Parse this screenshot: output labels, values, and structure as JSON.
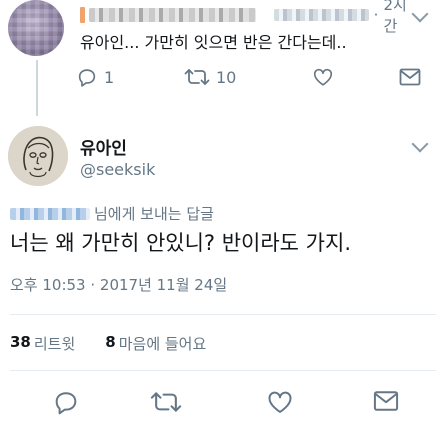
{
  "parent_tweet": {
    "time": "2시간",
    "separator": "·",
    "text": "유아인... 가만히 잇으면 반은 간다는데..",
    "reply_count": "1",
    "retweet_count": "10"
  },
  "main_tweet": {
    "display_name": "유아인",
    "handle": "@seeksik",
    "reply_to_suffix": "님에게 보내는 답글",
    "text": "너는 왜 가만히 안있니? 반이라도 가지.",
    "timestamp": "오후 10:53 · 2017년 11월 24일",
    "stats": {
      "retweets_count": "38",
      "retweets_label": "리트윗",
      "likes_count": "8",
      "likes_label": "마음에 들어요"
    }
  },
  "icons": {
    "reply": "reply-icon",
    "retweet": "retweet-icon",
    "like": "heart-icon",
    "dm": "envelope-icon",
    "menu": "chevron-down-icon"
  },
  "colors": {
    "text": "#14171a",
    "secondary": "#657786",
    "icon": "#657786",
    "divider": "#e6ecf0"
  }
}
